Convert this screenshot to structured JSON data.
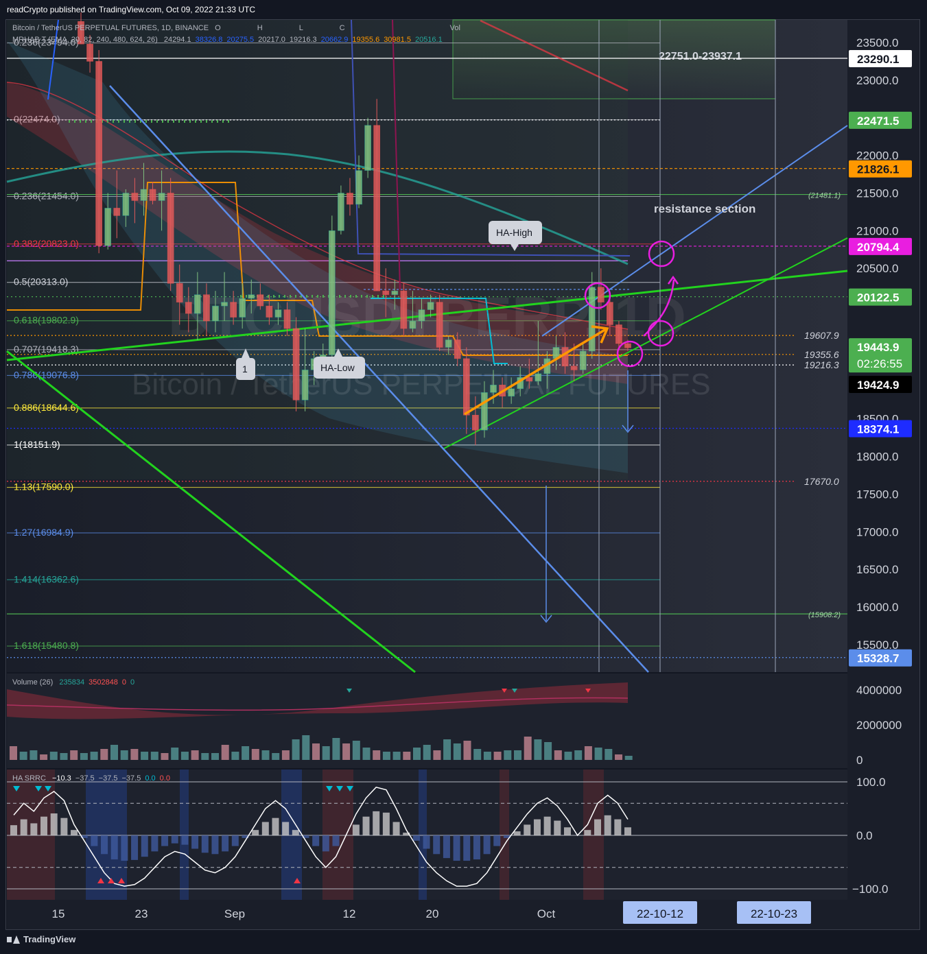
{
  "header": {
    "published": "readCrypto published on TradingView.com, Oct 09, 2022 21:33 UTC"
  },
  "legend": {
    "symbol": "Bitcoin / TetherUS PERPETUAL FUTURES, 1D, BINANCE",
    "ohlc": "O",
    "h": "H",
    "l": "L",
    "c": "C",
    "vol": "Vol",
    "indicator": "MRHAB T (EMA, 20, 82, 240, 480, 624, 26)",
    "ind_values": [
      "24294.1",
      "38326.8",
      "20275.5",
      "20217.0",
      "19216.3",
      "20662.9",
      "19355.6",
      "30981.5",
      "20516.1"
    ],
    "ind_colors": [
      "#b2b5be",
      "#2962ff",
      "#2962ff",
      "#b2b5be",
      "#b2b5be",
      "#2962ff",
      "#ff9800",
      "#ff9800",
      "#26a69a"
    ],
    "volume_label": "Volume (26)",
    "volume_values": [
      "235834",
      "3502848",
      "0",
      "0"
    ],
    "volume_colors": [
      "#26a69a",
      "#ff5252",
      "#ff5252",
      "#26a69a"
    ],
    "srrc_label": "HA SRRC",
    "srrc_values": [
      "−10.3",
      "−37.5",
      "−37.5",
      "−37.5",
      "0.0",
      "0.0"
    ],
    "srrc_colors": [
      "#ffffff",
      "#b2b5be",
      "#b2b5be",
      "#b2b5be",
      "#00bcd4",
      "#ff5252"
    ]
  },
  "watermark": {
    "ticker": "BTCUSDTPERP, 1D",
    "name": "Bitcoin / TetherUS PERPETUAL FUTURES"
  },
  "annotations": {
    "zone": "22751.0-23937.1",
    "resistance": "resistance section",
    "ha_high": "HA-High",
    "ha_low": "HA-Low",
    "one": "1"
  },
  "chart_data": {
    "type": "candlestick",
    "title": "Bitcoin / TetherUS PERPETUAL FUTURES, 1D, BINANCE",
    "ylim": [
      15150,
      23780
    ],
    "price_ticks": [
      "23500.0",
      "23000.0",
      "22000.0",
      "21500.0",
      "21000.0",
      "20500.0",
      "18500.0",
      "18000.0",
      "17500.0",
      "17000.0",
      "16500.0",
      "16000.0",
      "15500.0"
    ],
    "x_ticks": [
      "15",
      "23",
      "Sep",
      "12",
      "20",
      "Oct"
    ],
    "date_tags": [
      "22-10-12",
      "22-10-23"
    ],
    "price_badges": [
      {
        "label": "23290.1",
        "value": 23290.1,
        "color": "#ffffff",
        "text_color": "#131722"
      },
      {
        "label": "22471.5",
        "value": 22471.5,
        "color": "#4caf50",
        "text_color": "#ffffff"
      },
      {
        "label": "21826.1",
        "value": 21826.1,
        "color": "#ff9800",
        "text_color": "#131722"
      },
      {
        "label": "20794.4",
        "value": 20794.4,
        "color": "#e91ee0",
        "text_color": "#ffffff"
      },
      {
        "label": "20122.5",
        "value": 20122.5,
        "color": "#4caf50",
        "text_color": "#ffffff"
      },
      {
        "label": "18374.1",
        "value": 18374.1,
        "color": "#1e2cff",
        "text_color": "#ffffff"
      },
      {
        "label": "15328.7",
        "value": 15328.7,
        "color": "#5b8dea",
        "text_color": "#ffffff"
      }
    ],
    "last_price": {
      "value": 19443.9,
      "countdown": "02:26:55",
      "color": "#4caf50"
    },
    "cursor_price": {
      "value": 19424.9,
      "label": "19424.9"
    },
    "fib_levels": [
      {
        "label": "0.236(23494.0)",
        "value": 23494.0,
        "color": "#b2b5be"
      },
      {
        "label": "0(22474.0)",
        "value": 22474.0,
        "color": "#b2b5be"
      },
      {
        "label": "0.236(21454.0)",
        "value": 21454.0,
        "color": "#b2b5be"
      },
      {
        "label": "0.382(20823.0)",
        "value": 20823.0,
        "color": "#f23645"
      },
      {
        "label": "0.5(20313.0)",
        "value": 20313.0,
        "color": "#d1d4dc"
      },
      {
        "label": "0.618(19802.9)",
        "value": 19802.9,
        "color": "#4caf50"
      },
      {
        "label": "0.707(19418.3)",
        "value": 19418.3,
        "color": "#b2b5be"
      },
      {
        "label": "0.786(19076.8)",
        "value": 19076.8,
        "color": "#5b8dea"
      },
      {
        "label": "0.886(18644.6)",
        "value": 18644.6,
        "color": "#ffeb3b"
      },
      {
        "label": "1(18151.9)",
        "value": 18151.9,
        "color": "#ffffff"
      },
      {
        "label": "1.13(17590.0)",
        "value": 17590.0,
        "color": "#ffeb3b"
      },
      {
        "label": "1.27(16984.9)",
        "value": 16984.9,
        "color": "#5b8dea"
      },
      {
        "label": "1.414(16362.6)",
        "value": 16362.6,
        "color": "#26a69a"
      },
      {
        "label": "1.618(15480.8)",
        "value": 15480.8,
        "color": "#4caf50"
      }
    ],
    "side_levels": [
      {
        "label": "19607.9",
        "value": 19607.9,
        "color": "#ff9800"
      },
      {
        "label": "19355.6",
        "value": 19355.6,
        "color": "#ff9800"
      },
      {
        "label": "19216.3",
        "value": 19216.3,
        "color": "#b2b5be"
      },
      {
        "label": "17670.0",
        "value": 17670.0,
        "color": "#f23645"
      },
      {
        "label": "(21481.1)",
        "value": 21481.1,
        "color": "#4caf50"
      },
      {
        "label": "(15908.2)",
        "value": 15908.2,
        "color": "#4caf50"
      }
    ],
    "candles": [
      {
        "o": 23780,
        "h": 23900,
        "l": 23480,
        "c": 23480
      },
      {
        "o": 23480,
        "h": 23600,
        "l": 23100,
        "c": 23250
      },
      {
        "o": 23250,
        "h": 23400,
        "l": 20700,
        "c": 20800
      },
      {
        "o": 20800,
        "h": 21500,
        "l": 20750,
        "c": 21300
      },
      {
        "o": 21300,
        "h": 21800,
        "l": 20900,
        "c": 21200
      },
      {
        "o": 21200,
        "h": 21550,
        "l": 21050,
        "c": 21500
      },
      {
        "o": 21500,
        "h": 21700,
        "l": 21100,
        "c": 21400
      },
      {
        "o": 21400,
        "h": 21900,
        "l": 21200,
        "c": 21550
      },
      {
        "o": 21550,
        "h": 21650,
        "l": 21350,
        "c": 21400
      },
      {
        "o": 21400,
        "h": 21800,
        "l": 21000,
        "c": 21500
      },
      {
        "o": 21500,
        "h": 21700,
        "l": 20200,
        "c": 20300
      },
      {
        "o": 20300,
        "h": 20550,
        "l": 19750,
        "c": 20050
      },
      {
        "o": 20050,
        "h": 20250,
        "l": 19650,
        "c": 19900
      },
      {
        "o": 19900,
        "h": 20450,
        "l": 19550,
        "c": 20150
      },
      {
        "o": 20150,
        "h": 20300,
        "l": 19600,
        "c": 19800
      },
      {
        "o": 19800,
        "h": 20200,
        "l": 19650,
        "c": 20000
      },
      {
        "o": 20000,
        "h": 20450,
        "l": 19800,
        "c": 20050
      },
      {
        "o": 20050,
        "h": 20200,
        "l": 19750,
        "c": 19850
      },
      {
        "o": 19850,
        "h": 20300,
        "l": 19700,
        "c": 20100
      },
      {
        "o": 20100,
        "h": 20350,
        "l": 19900,
        "c": 20150
      },
      {
        "o": 20150,
        "h": 20300,
        "l": 19950,
        "c": 20000
      },
      {
        "o": 20000,
        "h": 20150,
        "l": 19750,
        "c": 19850
      },
      {
        "o": 19850,
        "h": 20050,
        "l": 19750,
        "c": 19950
      },
      {
        "o": 19950,
        "h": 20050,
        "l": 19600,
        "c": 19700
      },
      {
        "o": 19700,
        "h": 19850,
        "l": 18600,
        "c": 18750
      },
      {
        "o": 18750,
        "h": 19700,
        "l": 18600,
        "c": 19150
      },
      {
        "o": 19150,
        "h": 19400,
        "l": 18950,
        "c": 19300
      },
      {
        "o": 19300,
        "h": 19500,
        "l": 19150,
        "c": 19350
      },
      {
        "o": 19350,
        "h": 21200,
        "l": 19250,
        "c": 21000
      },
      {
        "o": 21000,
        "h": 21600,
        "l": 20950,
        "c": 21500
      },
      {
        "o": 21500,
        "h": 21700,
        "l": 21200,
        "c": 21350
      },
      {
        "o": 21350,
        "h": 22000,
        "l": 21300,
        "c": 21800
      },
      {
        "o": 21800,
        "h": 22500,
        "l": 21700,
        "c": 22400
      },
      {
        "o": 22400,
        "h": 22750,
        "l": 20200,
        "c": 20200
      },
      {
        "o": 20200,
        "h": 20500,
        "l": 19850,
        "c": 20150
      },
      {
        "o": 20150,
        "h": 20350,
        "l": 19950,
        "c": 20200
      },
      {
        "o": 20200,
        "h": 20300,
        "l": 19600,
        "c": 19700
      },
      {
        "o": 19700,
        "h": 20200,
        "l": 19650,
        "c": 19800
      },
      {
        "o": 19800,
        "h": 20100,
        "l": 19700,
        "c": 19950
      },
      {
        "o": 19950,
        "h": 20150,
        "l": 19850,
        "c": 20050
      },
      {
        "o": 20050,
        "h": 20150,
        "l": 19400,
        "c": 19450
      },
      {
        "o": 19450,
        "h": 19600,
        "l": 19350,
        "c": 19550
      },
      {
        "o": 19550,
        "h": 19650,
        "l": 19200,
        "c": 19300
      },
      {
        "o": 19300,
        "h": 19450,
        "l": 18300,
        "c": 18550
      },
      {
        "o": 18550,
        "h": 18800,
        "l": 18150,
        "c": 18350
      },
      {
        "o": 18350,
        "h": 19000,
        "l": 18250,
        "c": 18850
      },
      {
        "o": 18850,
        "h": 19150,
        "l": 18700,
        "c": 18950
      },
      {
        "o": 18950,
        "h": 19050,
        "l": 18650,
        "c": 18800
      },
      {
        "o": 18800,
        "h": 19050,
        "l": 18700,
        "c": 18900
      },
      {
        "o": 18900,
        "h": 19200,
        "l": 18800,
        "c": 19050
      },
      {
        "o": 19050,
        "h": 19300,
        "l": 18900,
        "c": 19000
      },
      {
        "o": 19000,
        "h": 19800,
        "l": 18950,
        "c": 19100
      },
      {
        "o": 19100,
        "h": 19400,
        "l": 18900,
        "c": 19300
      },
      {
        "o": 19300,
        "h": 19600,
        "l": 19150,
        "c": 19450
      },
      {
        "o": 19450,
        "h": 19650,
        "l": 19100,
        "c": 19200
      },
      {
        "o": 19200,
        "h": 19500,
        "l": 19000,
        "c": 19150
      },
      {
        "o": 19150,
        "h": 19500,
        "l": 19100,
        "c": 19400
      },
      {
        "o": 19400,
        "h": 20450,
        "l": 19300,
        "c": 20250
      },
      {
        "o": 20250,
        "h": 20500,
        "l": 19950,
        "c": 20050
      },
      {
        "o": 20050,
        "h": 20150,
        "l": 19600,
        "c": 19750
      },
      {
        "o": 19750,
        "h": 19800,
        "l": 19450,
        "c": 19500
      },
      {
        "o": 19500,
        "h": 19550,
        "l": 19400,
        "c": 19444
      }
    ]
  }
}
